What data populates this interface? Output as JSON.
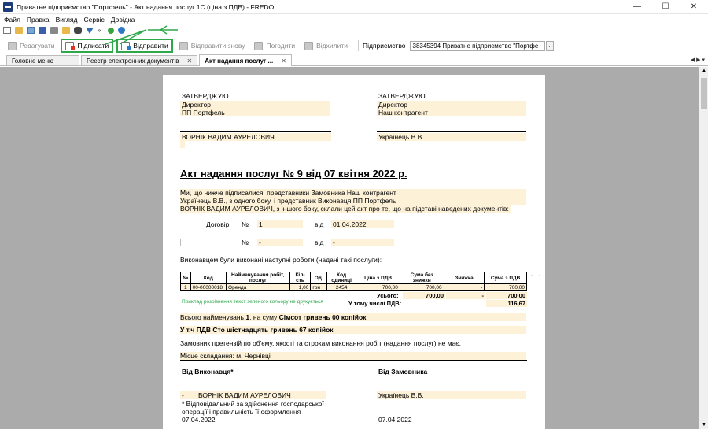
{
  "window": {
    "title": "Приватне підприємство \"Портфель\" - Акт надання послуг 1С (ціна з ПДВ) - FREDO",
    "minimize": "—",
    "maximize": "☐",
    "close": "✕"
  },
  "menu": [
    "Файл",
    "Правка",
    "Вигляд",
    "Сервіс",
    "Довідка"
  ],
  "toolbar": {
    "edit": "Редагувати",
    "sign": "Підписати",
    "send": "Відправити",
    "resend": "Відправити знову",
    "approve": "Погодити",
    "reject": "Відхилити",
    "enterprise_label": "Підприємство",
    "enterprise_value": "38345394  Приватне підприємство \"Портфе",
    "enterprise_btn": "..."
  },
  "tabs": [
    {
      "label": "Головне меню"
    },
    {
      "label": "Реєстр електронних документів"
    },
    {
      "label": "Акт надання послуг ..."
    }
  ],
  "tab_nav": "◀ ▶ ▾",
  "document": {
    "approve_left": "ЗАТВЕРДЖУЮ",
    "approve_left_pos": "Директор",
    "approve_left_org": "ПП Портфель",
    "approve_right": "ЗАТВЕРДЖУЮ",
    "approve_right_pos": "Директор",
    "approve_right_org": "Наш контрагент",
    "sign_left": "ВОРНІК ВАДИМ АУРЕЛОВИЧ",
    "sign_right": "Українець В.В.",
    "title": "Акт надання послуг № 9 від 07 квітня 2022 р.",
    "intro1": "Ми, що нижче підписалися, представники Замовника Наш контрагент",
    "intro2": "Українець В.В., з одного боку, і представник Виконавця ПП Портфель",
    "intro3": "ВОРНІК ВАДИМ АУРЕЛОВИЧ, з іншого боку, склали цей акт про те, що на підставі наведених документів:",
    "contract_label": "Договір:",
    "no_label": "№",
    "contract_no": "1",
    "from_label": "від",
    "contract_date": "01.04.2022",
    "no2": "-",
    "date2": "-",
    "works_intro": "Виконавцем були виконані наступні роботи (надані такі послуги):",
    "table_headers": [
      "№",
      "Код",
      "Найменування робіт, послуг",
      "Кіл-сть",
      "Од.",
      "Код одиниці",
      "Ціна з ПДВ",
      "Сума без знижки",
      "Знижка",
      "Сума з ПДВ"
    ],
    "table_rows": [
      [
        "1",
        "00-00000018",
        "Оренда",
        "1,00",
        "грн",
        "2454",
        "700,00",
        "700,00",
        "-",
        "700,00"
      ]
    ],
    "total_label": "Усього:",
    "total_no_disc": "700,00",
    "total_disc": "-",
    "total": "700,00",
    "vat_label": "У тому числі ПДВ:",
    "vat": "116,67",
    "green_note": "Приклад розрізнення текст зеленого кольору не друкується",
    "ghost_mark": "-",
    "sum_text_prefix": "Всього найменувань",
    "sum_count": "1",
    "sum_text_mid": ", на суму",
    "sum_words": "Сімсот гривень 00 копійок",
    "vat_text_label": "У т.ч ПДВ",
    "vat_words": "Сто шістнадцять гривень 67 копійок",
    "claims": "Замовник претензій по об'єму, якості та строкам виконання робіт (надання послуг) не має.",
    "place": "Місце складання:  м. Чернівці",
    "from_executor": "Від Виконавця*",
    "from_customer": "Від Замовника",
    "exec_dash": "-",
    "exec_name": "ВОРНІК ВАДИМ АУРЕЛОВИЧ",
    "cust_name": "Українець  В.В.",
    "resp_note1": "* Відповідальний за здійснення господарської",
    "resp_note2": "операції і правильність її оформлення",
    "bottom_date_left": "07.04.2022",
    "bottom_date_right": "07.04.2022"
  },
  "scroll": {
    "up": "▲",
    "down": "▼"
  }
}
